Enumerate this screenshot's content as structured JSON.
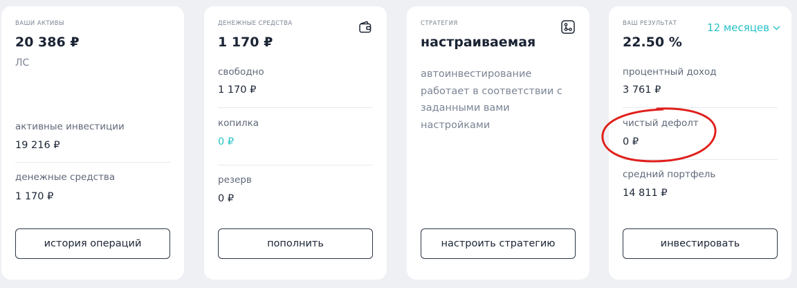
{
  "assets": {
    "caption": "ваши активы",
    "total": "20 386 ₽",
    "account": "ЛС",
    "active_label": "активные инвестиции",
    "active_value": "19 216 ₽",
    "cash_label": "денежные средства",
    "cash_value": "1 170 ₽",
    "button": "история операций"
  },
  "cash": {
    "caption": "денежные средства",
    "icon": "wallet-icon",
    "total": "1 170 ₽",
    "free_label": "свободно",
    "free_value": "1 170 ₽",
    "piggy_label": "копилка",
    "piggy_value": "0 ₽",
    "reserve_label": "резерв",
    "reserve_value": "0 ₽",
    "button": "пополнить"
  },
  "strategy": {
    "caption": "стратегия",
    "icon": "strategy-flow-icon",
    "name": "настраиваемая",
    "description": "автоинвестирование работает в соответствии с заданными вами настройками",
    "button": "настроить стратегию"
  },
  "result": {
    "caption": "ваш результат",
    "period": "12 месяцев",
    "total": "22.50 %",
    "interest_label": "процентный доход",
    "interest_value": "3 761 ₽",
    "default_label": "чистый дефолт",
    "default_value": "0 ₽",
    "portfolio_label": "средний портфель",
    "portfolio_value": "14 811 ₽",
    "button": "инвестировать"
  },
  "colors": {
    "accent": "#27c1c6",
    "annotation": "#e0201c",
    "background": "#eef0f4"
  }
}
